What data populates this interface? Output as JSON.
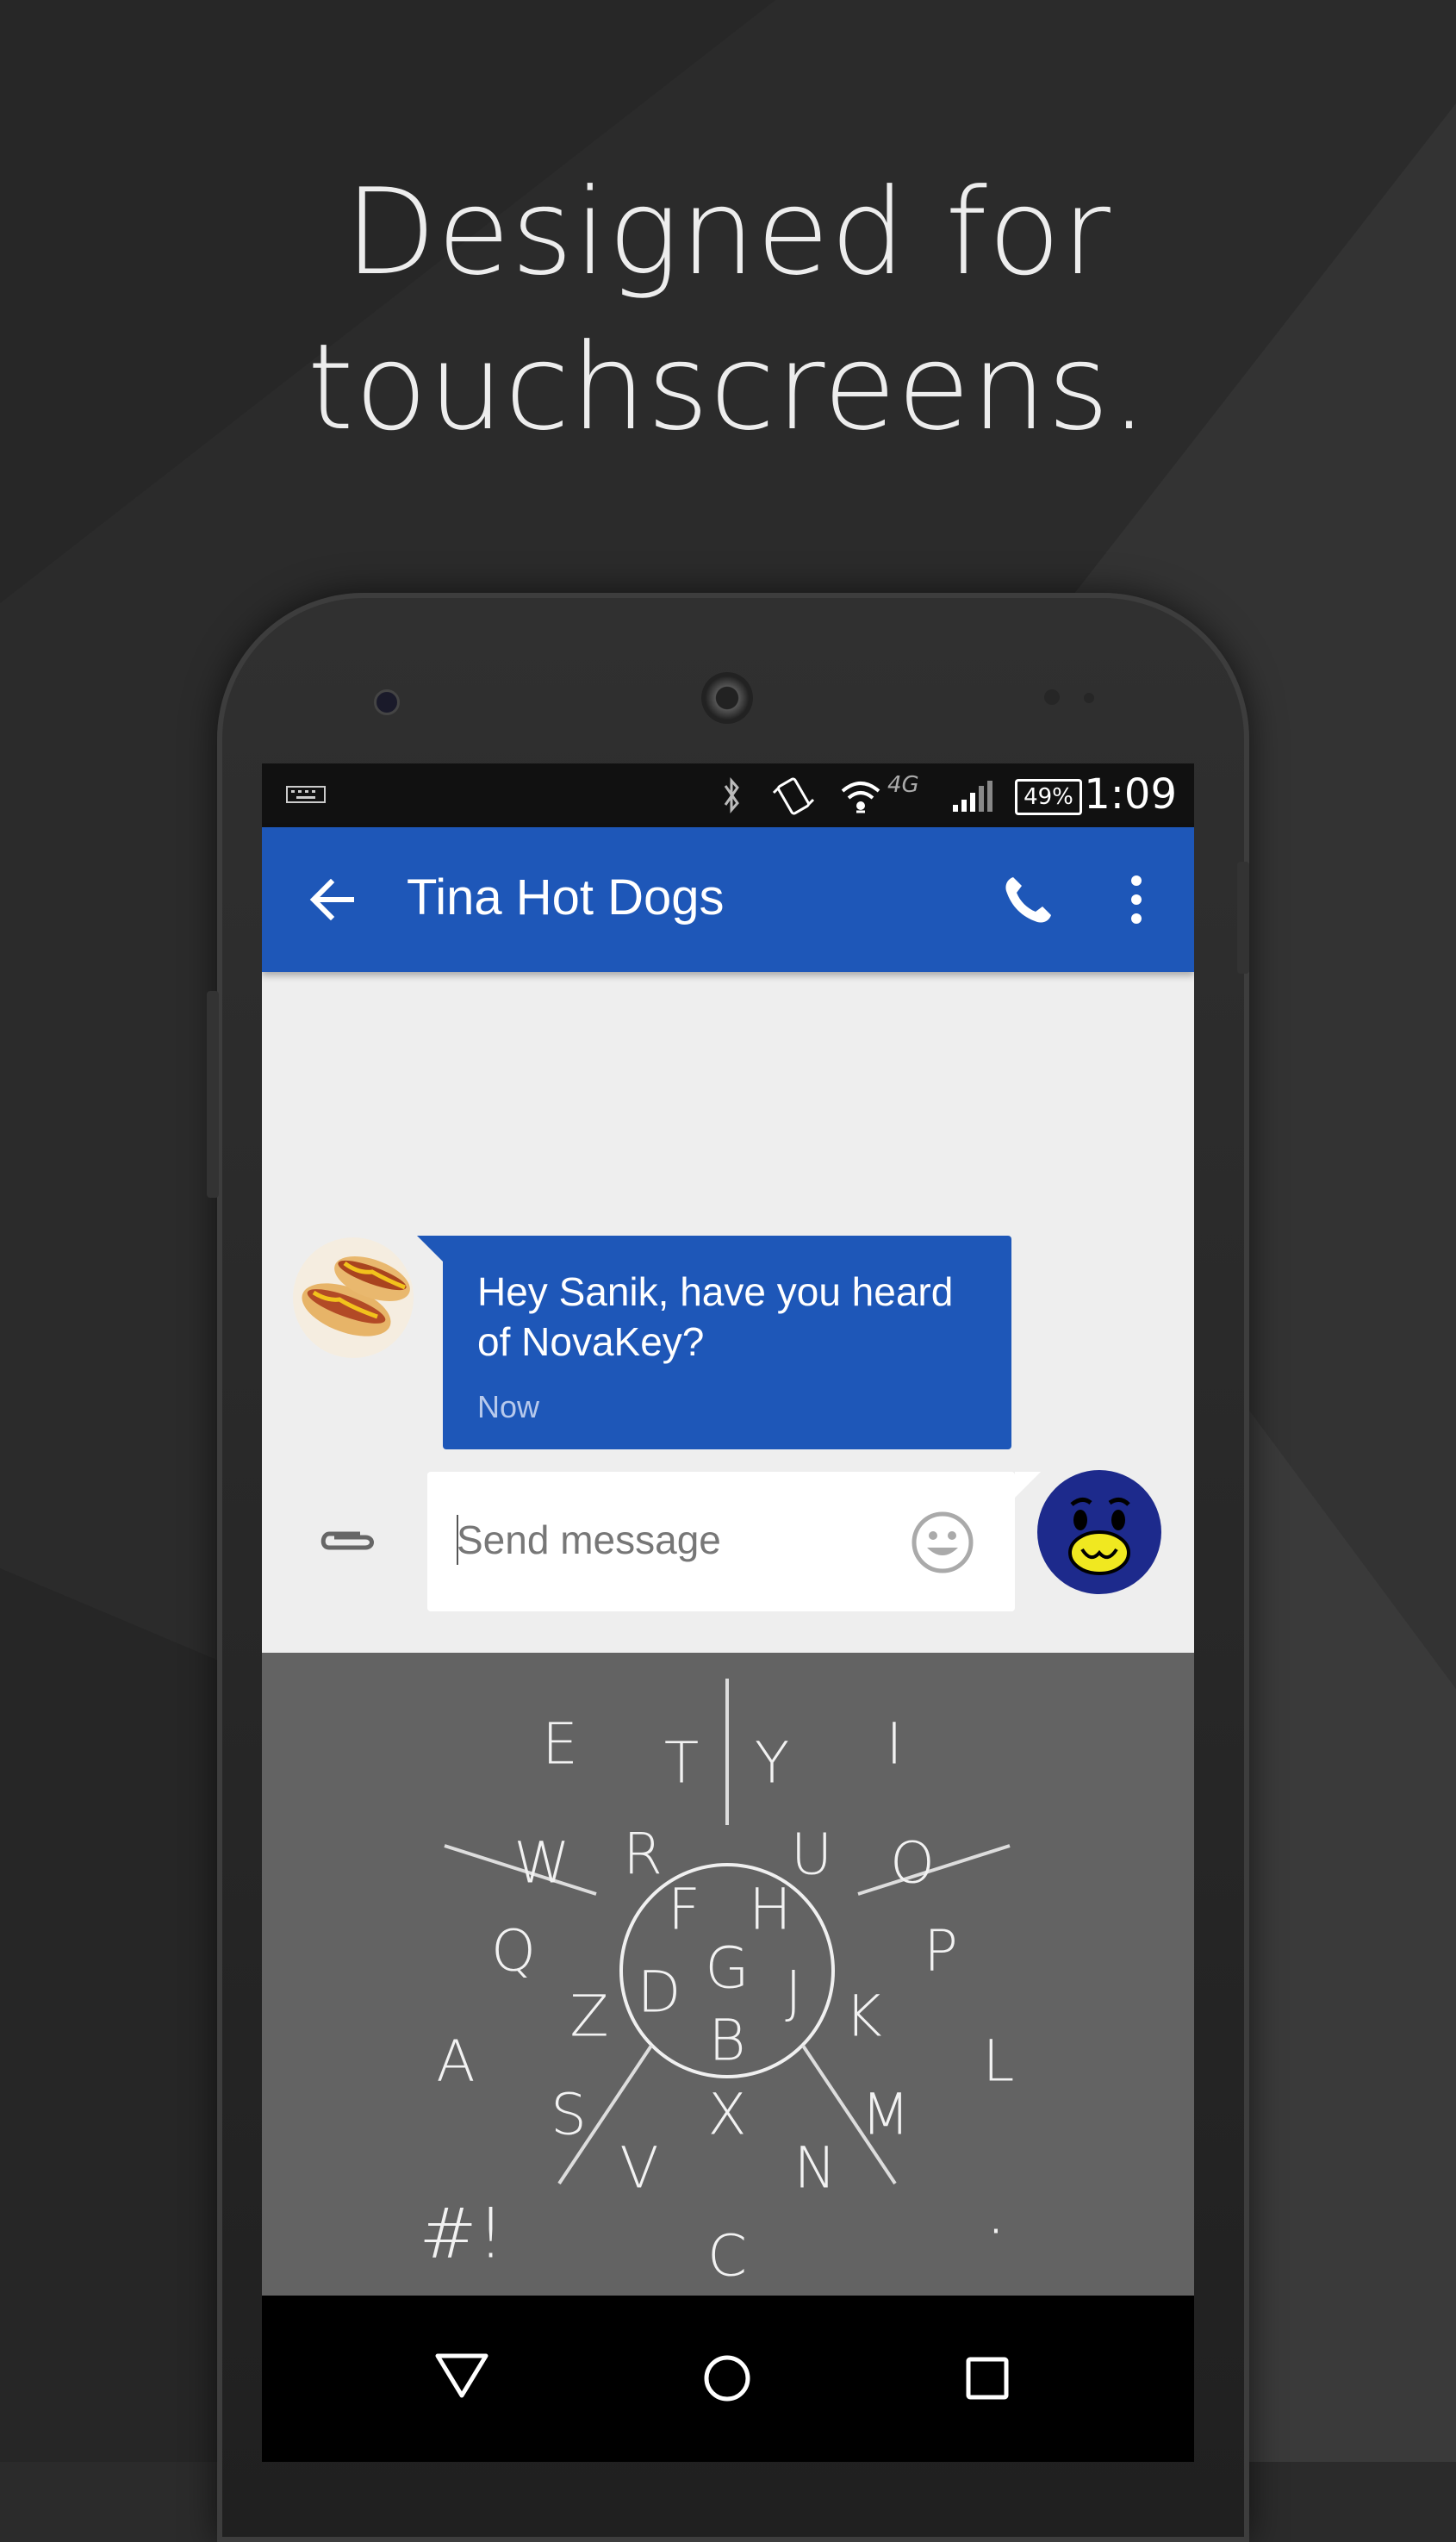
{
  "headline": {
    "line1": "Designed for",
    "line2": "touchscreens."
  },
  "status_bar": {
    "battery": "49%",
    "time": "1:09",
    "network": "4G"
  },
  "app_bar": {
    "title": "Tina Hot Dogs"
  },
  "conversation": {
    "incoming": {
      "text": "Hey Sanik, have you heard of NovaKey?",
      "time": "Now"
    }
  },
  "compose": {
    "placeholder": "Send message"
  },
  "keyboard": {
    "keys": [
      "E",
      "T",
      "Y",
      "I",
      "W",
      "R",
      "U",
      "O",
      "Q",
      "P",
      "F",
      "H",
      "G",
      "D",
      "J",
      "Z",
      "K",
      "B",
      "A",
      "L",
      "S",
      "X",
      "M",
      "V",
      "N",
      "#!",
      "C",
      "."
    ]
  },
  "colors": {
    "accent": "#1e57b8",
    "keyboard_bg": "#636363",
    "page_bg": "#2b2b2b"
  },
  "icons": {
    "back": "arrow-left-icon",
    "call": "phone-icon",
    "menu": "more-vert-icon",
    "attach": "paperclip-icon",
    "emoji": "smiley-icon",
    "nav_back": "triangle-back-icon",
    "nav_home": "circle-home-icon",
    "nav_recents": "square-recents-icon"
  }
}
